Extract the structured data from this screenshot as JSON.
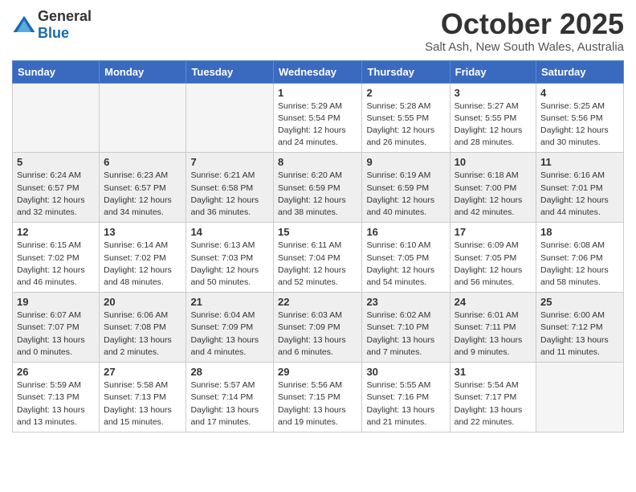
{
  "logo": {
    "general": "General",
    "blue": "Blue"
  },
  "title": "October 2025",
  "location": "Salt Ash, New South Wales, Australia",
  "days_of_week": [
    "Sunday",
    "Monday",
    "Tuesday",
    "Wednesday",
    "Thursday",
    "Friday",
    "Saturday"
  ],
  "weeks": [
    [
      {
        "day": "",
        "info": ""
      },
      {
        "day": "",
        "info": ""
      },
      {
        "day": "",
        "info": ""
      },
      {
        "day": "1",
        "info": "Sunrise: 5:29 AM\nSunset: 5:54 PM\nDaylight: 12 hours\nand 24 minutes."
      },
      {
        "day": "2",
        "info": "Sunrise: 5:28 AM\nSunset: 5:55 PM\nDaylight: 12 hours\nand 26 minutes."
      },
      {
        "day": "3",
        "info": "Sunrise: 5:27 AM\nSunset: 5:55 PM\nDaylight: 12 hours\nand 28 minutes."
      },
      {
        "day": "4",
        "info": "Sunrise: 5:25 AM\nSunset: 5:56 PM\nDaylight: 12 hours\nand 30 minutes."
      }
    ],
    [
      {
        "day": "5",
        "info": "Sunrise: 6:24 AM\nSunset: 6:57 PM\nDaylight: 12 hours\nand 32 minutes."
      },
      {
        "day": "6",
        "info": "Sunrise: 6:23 AM\nSunset: 6:57 PM\nDaylight: 12 hours\nand 34 minutes."
      },
      {
        "day": "7",
        "info": "Sunrise: 6:21 AM\nSunset: 6:58 PM\nDaylight: 12 hours\nand 36 minutes."
      },
      {
        "day": "8",
        "info": "Sunrise: 6:20 AM\nSunset: 6:59 PM\nDaylight: 12 hours\nand 38 minutes."
      },
      {
        "day": "9",
        "info": "Sunrise: 6:19 AM\nSunset: 6:59 PM\nDaylight: 12 hours\nand 40 minutes."
      },
      {
        "day": "10",
        "info": "Sunrise: 6:18 AM\nSunset: 7:00 PM\nDaylight: 12 hours\nand 42 minutes."
      },
      {
        "day": "11",
        "info": "Sunrise: 6:16 AM\nSunset: 7:01 PM\nDaylight: 12 hours\nand 44 minutes."
      }
    ],
    [
      {
        "day": "12",
        "info": "Sunrise: 6:15 AM\nSunset: 7:02 PM\nDaylight: 12 hours\nand 46 minutes."
      },
      {
        "day": "13",
        "info": "Sunrise: 6:14 AM\nSunset: 7:02 PM\nDaylight: 12 hours\nand 48 minutes."
      },
      {
        "day": "14",
        "info": "Sunrise: 6:13 AM\nSunset: 7:03 PM\nDaylight: 12 hours\nand 50 minutes."
      },
      {
        "day": "15",
        "info": "Sunrise: 6:11 AM\nSunset: 7:04 PM\nDaylight: 12 hours\nand 52 minutes."
      },
      {
        "day": "16",
        "info": "Sunrise: 6:10 AM\nSunset: 7:05 PM\nDaylight: 12 hours\nand 54 minutes."
      },
      {
        "day": "17",
        "info": "Sunrise: 6:09 AM\nSunset: 7:05 PM\nDaylight: 12 hours\nand 56 minutes."
      },
      {
        "day": "18",
        "info": "Sunrise: 6:08 AM\nSunset: 7:06 PM\nDaylight: 12 hours\nand 58 minutes."
      }
    ],
    [
      {
        "day": "19",
        "info": "Sunrise: 6:07 AM\nSunset: 7:07 PM\nDaylight: 13 hours\nand 0 minutes."
      },
      {
        "day": "20",
        "info": "Sunrise: 6:06 AM\nSunset: 7:08 PM\nDaylight: 13 hours\nand 2 minutes."
      },
      {
        "day": "21",
        "info": "Sunrise: 6:04 AM\nSunset: 7:09 PM\nDaylight: 13 hours\nand 4 minutes."
      },
      {
        "day": "22",
        "info": "Sunrise: 6:03 AM\nSunset: 7:09 PM\nDaylight: 13 hours\nand 6 minutes."
      },
      {
        "day": "23",
        "info": "Sunrise: 6:02 AM\nSunset: 7:10 PM\nDaylight: 13 hours\nand 7 minutes."
      },
      {
        "day": "24",
        "info": "Sunrise: 6:01 AM\nSunset: 7:11 PM\nDaylight: 13 hours\nand 9 minutes."
      },
      {
        "day": "25",
        "info": "Sunrise: 6:00 AM\nSunset: 7:12 PM\nDaylight: 13 hours\nand 11 minutes."
      }
    ],
    [
      {
        "day": "26",
        "info": "Sunrise: 5:59 AM\nSunset: 7:13 PM\nDaylight: 13 hours\nand 13 minutes."
      },
      {
        "day": "27",
        "info": "Sunrise: 5:58 AM\nSunset: 7:13 PM\nDaylight: 13 hours\nand 15 minutes."
      },
      {
        "day": "28",
        "info": "Sunrise: 5:57 AM\nSunset: 7:14 PM\nDaylight: 13 hours\nand 17 minutes."
      },
      {
        "day": "29",
        "info": "Sunrise: 5:56 AM\nSunset: 7:15 PM\nDaylight: 13 hours\nand 19 minutes."
      },
      {
        "day": "30",
        "info": "Sunrise: 5:55 AM\nSunset: 7:16 PM\nDaylight: 13 hours\nand 21 minutes."
      },
      {
        "day": "31",
        "info": "Sunrise: 5:54 AM\nSunset: 7:17 PM\nDaylight: 13 hours\nand 22 minutes."
      },
      {
        "day": "",
        "info": ""
      }
    ]
  ]
}
